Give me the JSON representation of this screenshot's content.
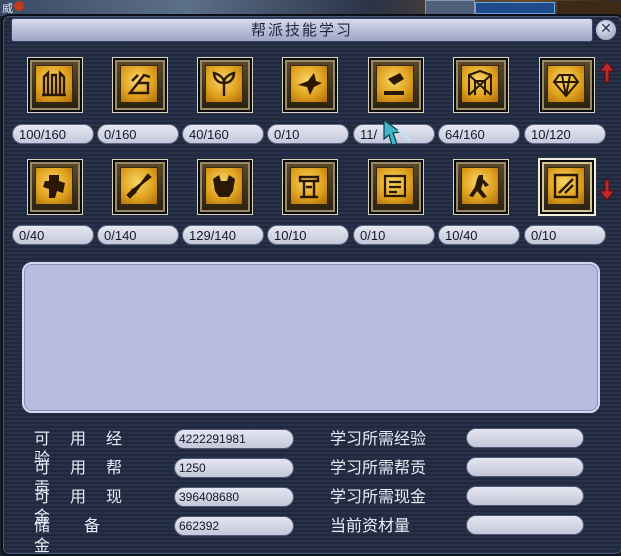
{
  "world": {
    "label": "威"
  },
  "window": {
    "title": "帮派技能学习",
    "close_glyph": "✕"
  },
  "skills_row1": [
    {
      "icon": "tower-icon",
      "level": "100/160"
    },
    {
      "icon": "crane-icon",
      "level": "0/160"
    },
    {
      "icon": "plant-icon",
      "level": "40/160"
    },
    {
      "icon": "bird-icon",
      "level": "0/10"
    },
    {
      "icon": "hammer-icon",
      "level": "11/"
    },
    {
      "icon": "shrine-icon",
      "level": "64/160"
    },
    {
      "icon": "crystal-icon",
      "level": "10/120"
    }
  ],
  "skills_row2": [
    {
      "icon": "strongman-icon",
      "level": "0/40"
    },
    {
      "icon": "blade-icon",
      "level": "0/140"
    },
    {
      "icon": "beast-icon",
      "level": "129/140"
    },
    {
      "icon": "forge-icon",
      "level": "10/10"
    },
    {
      "icon": "scroll-icon",
      "level": "0/10"
    },
    {
      "icon": "runner-icon",
      "level": "10/40"
    },
    {
      "icon": "chisel-icon",
      "level": "0/10"
    }
  ],
  "scroll": {
    "up_icon": "arrow-up-icon",
    "down_icon": "arrow-down-icon"
  },
  "stats": {
    "exp_label": "可用经验",
    "exp_value": "4222291981",
    "contrib_label": "可用帮贡",
    "contrib_value": "1250",
    "cash_label": "可用现金",
    "cash_value": "396408680",
    "reserve_label": "储备金",
    "reserve_value": "662392",
    "req_exp_label": "学习所需经验",
    "req_contrib_label": "学习所需帮贡",
    "req_cash_label": "学习所需现金",
    "materials_label": "当前资材量"
  },
  "colors": {
    "accent": "#e0a21e",
    "panel": "#b8bbdf",
    "arrow": "#c0282a"
  }
}
